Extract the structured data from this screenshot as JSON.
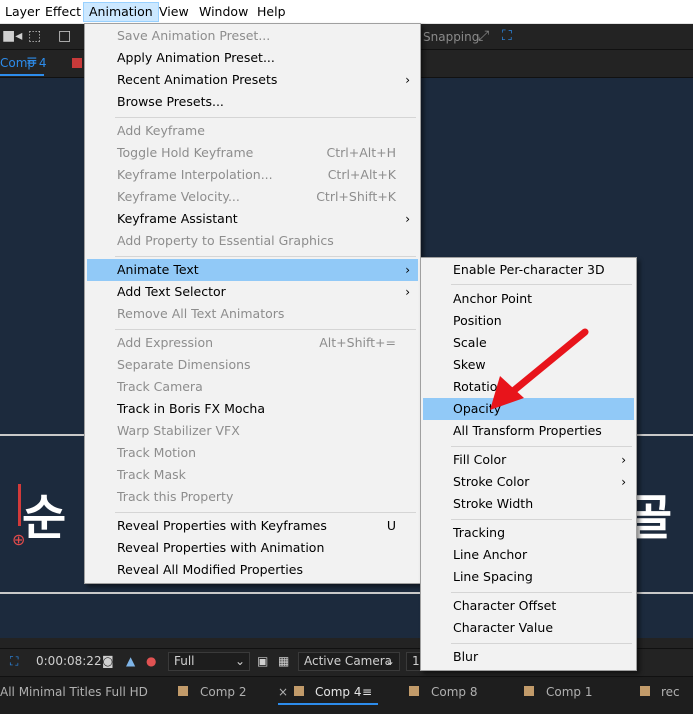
{
  "menubar": {
    "items": [
      "Layer",
      "Effect",
      "Animation",
      "View",
      "Window",
      "Help"
    ]
  },
  "toolbar": {
    "snapping_label": "Snapping"
  },
  "composition": {
    "tab_label": "Comp 4"
  },
  "viewer": {
    "text_left": "순",
    "text_right": "골"
  },
  "viewer_bar": {
    "timecode": "0:00:08:22",
    "resolution": "Full",
    "camera": "Active Camera",
    "views_partial": "1"
  },
  "timeline_tabs": {
    "project_label": "All Minimal Titles Full HD",
    "tabs": [
      "Comp 2",
      "Comp 4",
      "Comp 8",
      "Comp 1",
      "rec"
    ],
    "close_glyph": "×"
  },
  "animation_menu": {
    "groups": [
      [
        {
          "label": "Save Animation Preset...",
          "enabled": false
        },
        {
          "label": "Apply Animation Preset...",
          "enabled": true
        },
        {
          "label": "Recent Animation Presets",
          "enabled": true,
          "submenu": true
        },
        {
          "label": "Browse Presets...",
          "enabled": true
        }
      ],
      [
        {
          "label": "Add Keyframe",
          "enabled": false
        },
        {
          "label": "Toggle Hold Keyframe",
          "enabled": false,
          "shortcut": "Ctrl+Alt+H"
        },
        {
          "label": "Keyframe Interpolation...",
          "enabled": false,
          "shortcut": "Ctrl+Alt+K"
        },
        {
          "label": "Keyframe Velocity...",
          "enabled": false,
          "shortcut": "Ctrl+Shift+K"
        },
        {
          "label": "Keyframe Assistant",
          "enabled": true,
          "submenu": true
        },
        {
          "label": "Add Property to Essential Graphics",
          "enabled": false
        }
      ],
      [
        {
          "label": "Animate Text",
          "enabled": true,
          "submenu": true,
          "highlighted": true
        },
        {
          "label": "Add Text Selector",
          "enabled": true,
          "submenu": true
        },
        {
          "label": "Remove All Text Animators",
          "enabled": false
        }
      ],
      [
        {
          "label": "Add Expression",
          "enabled": false,
          "shortcut": "Alt+Shift+="
        },
        {
          "label": "Separate Dimensions",
          "enabled": false
        },
        {
          "label": "Track Camera",
          "enabled": false
        },
        {
          "label": "Track in Boris FX Mocha",
          "enabled": true
        },
        {
          "label": "Warp Stabilizer VFX",
          "enabled": false
        },
        {
          "label": "Track Motion",
          "enabled": false
        },
        {
          "label": "Track Mask",
          "enabled": false
        },
        {
          "label": "Track this Property",
          "enabled": false
        }
      ],
      [
        {
          "label": "Reveal Properties with Keyframes",
          "enabled": true,
          "shortcut": "U"
        },
        {
          "label": "Reveal Properties with Animation",
          "enabled": true
        },
        {
          "label": "Reveal All Modified Properties",
          "enabled": true
        }
      ]
    ]
  },
  "animate_text_submenu": {
    "groups": [
      [
        {
          "label": "Enable Per-character 3D"
        }
      ],
      [
        {
          "label": "Anchor Point"
        },
        {
          "label": "Position"
        },
        {
          "label": "Scale"
        },
        {
          "label": "Skew"
        },
        {
          "label": "Rotation"
        },
        {
          "label": "Opacity",
          "highlighted": true
        },
        {
          "label": "All Transform Properties"
        }
      ],
      [
        {
          "label": "Fill Color",
          "submenu": true
        },
        {
          "label": "Stroke Color",
          "submenu": true
        },
        {
          "label": "Stroke Width"
        }
      ],
      [
        {
          "label": "Tracking"
        },
        {
          "label": "Line Anchor"
        },
        {
          "label": "Line Spacing"
        }
      ],
      [
        {
          "label": "Character Offset"
        },
        {
          "label": "Character Value"
        }
      ],
      [
        {
          "label": "Blur"
        }
      ]
    ]
  },
  "icons": {
    "submenu_arrow": "›",
    "hamburger": "≡",
    "anchor": "⊕",
    "camera": "📷",
    "dropdown": "⌄"
  },
  "colors": {
    "highlight": "#91c9f7",
    "annotation_arrow": "#e8141b",
    "active_tab": "#2d8ceb"
  }
}
